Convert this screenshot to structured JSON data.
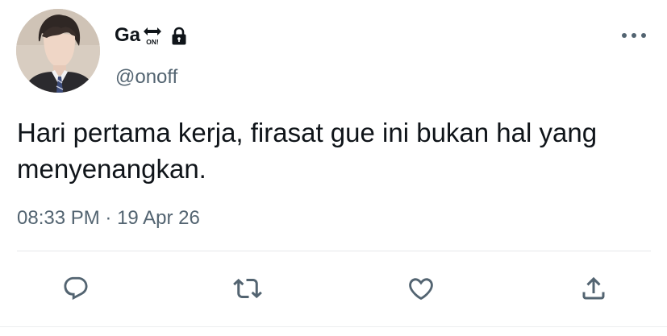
{
  "user": {
    "display_name": "Ga",
    "handle": "@onoff",
    "name_emoji_text": "ON!"
  },
  "tweet": {
    "text": "Hari pertama kerja, firasat gue ini bukan hal yang menyenangkan.",
    "time": "08:33 PM",
    "separator": " · ",
    "date": "19 Apr 26"
  },
  "icons": {
    "name_badge": "on-arrow-emoji-icon",
    "lock": "lock-icon",
    "more": "more-horizontal-icon",
    "reply": "reply-icon",
    "retweet": "retweet-icon",
    "like": "heart-icon",
    "share": "share-icon"
  },
  "colors": {
    "primary_text": "#0f1419",
    "secondary_text": "#536471",
    "divider": "#e6e8ea"
  }
}
